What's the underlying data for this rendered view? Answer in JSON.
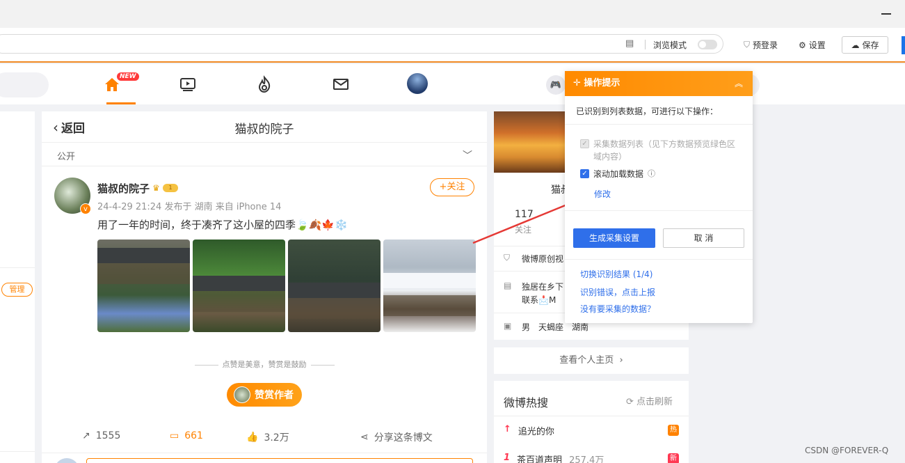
{
  "toolbar": {
    "browse_mode": "浏览模式",
    "prelogin": "预登录",
    "settings": "设置",
    "save": "保存"
  },
  "nav": {
    "new_badge": "NEW"
  },
  "left": {
    "manage": "管理"
  },
  "post": {
    "back": "返回",
    "page_title": "猫叔的院子",
    "visibility": "公开",
    "author": "猫叔的院子",
    "level_badge": "1",
    "meta": "24-4-29 21:24 发布于 湖南 来自 iPhone 14",
    "follow": "+关注",
    "text": "用了一年的时间，终于凑齐了这小屋的四季🍃🍂🍁❄️",
    "praise_line": "点赞是美意，赞赏是鼓励",
    "reward": "赞赏作者",
    "reposts": "1555",
    "comments": "661",
    "likes": "3.2万",
    "share": "分享这条博文"
  },
  "profile": {
    "name": "猫叔",
    "count": "117",
    "count_label": "关注",
    "info1": "微博原创视",
    "info2_line1": "独居在乡下",
    "info2_line2": "联系📩M",
    "gender": "男",
    "zodiac": "天蝎座",
    "location": "湖南",
    "view_home": "查看个人主页"
  },
  "hot": {
    "title": "微博热搜",
    "refresh": "点击刷新",
    "items": [
      {
        "rank": "↑",
        "text": "追光的你",
        "tag": "热",
        "color": "#ff8200"
      },
      {
        "rank": "1",
        "text": "茶百道声明",
        "count": "257.4万",
        "tag": "新",
        "color": "#ff3852"
      }
    ]
  },
  "panel": {
    "title": "操作提示",
    "collapse": "︽",
    "desc": "已识别到列表数据，可进行以下操作：",
    "option1": "采集数据列表（见下方数据预览绿色区域内容）",
    "option2": "滚动加载数据",
    "modify": "修改",
    "generate": "生成采集设置",
    "cancel": "取 消",
    "link1": "切换识别结果 (1/4)",
    "link2": "识别错误，点击上报",
    "link3": "没有要采集的数据？"
  },
  "watermark": "CSDN @FOREVER-Q",
  "colors": {
    "accent": "#ff8200",
    "link_blue": "#2f6fea",
    "arrow_red": "#e53935"
  }
}
